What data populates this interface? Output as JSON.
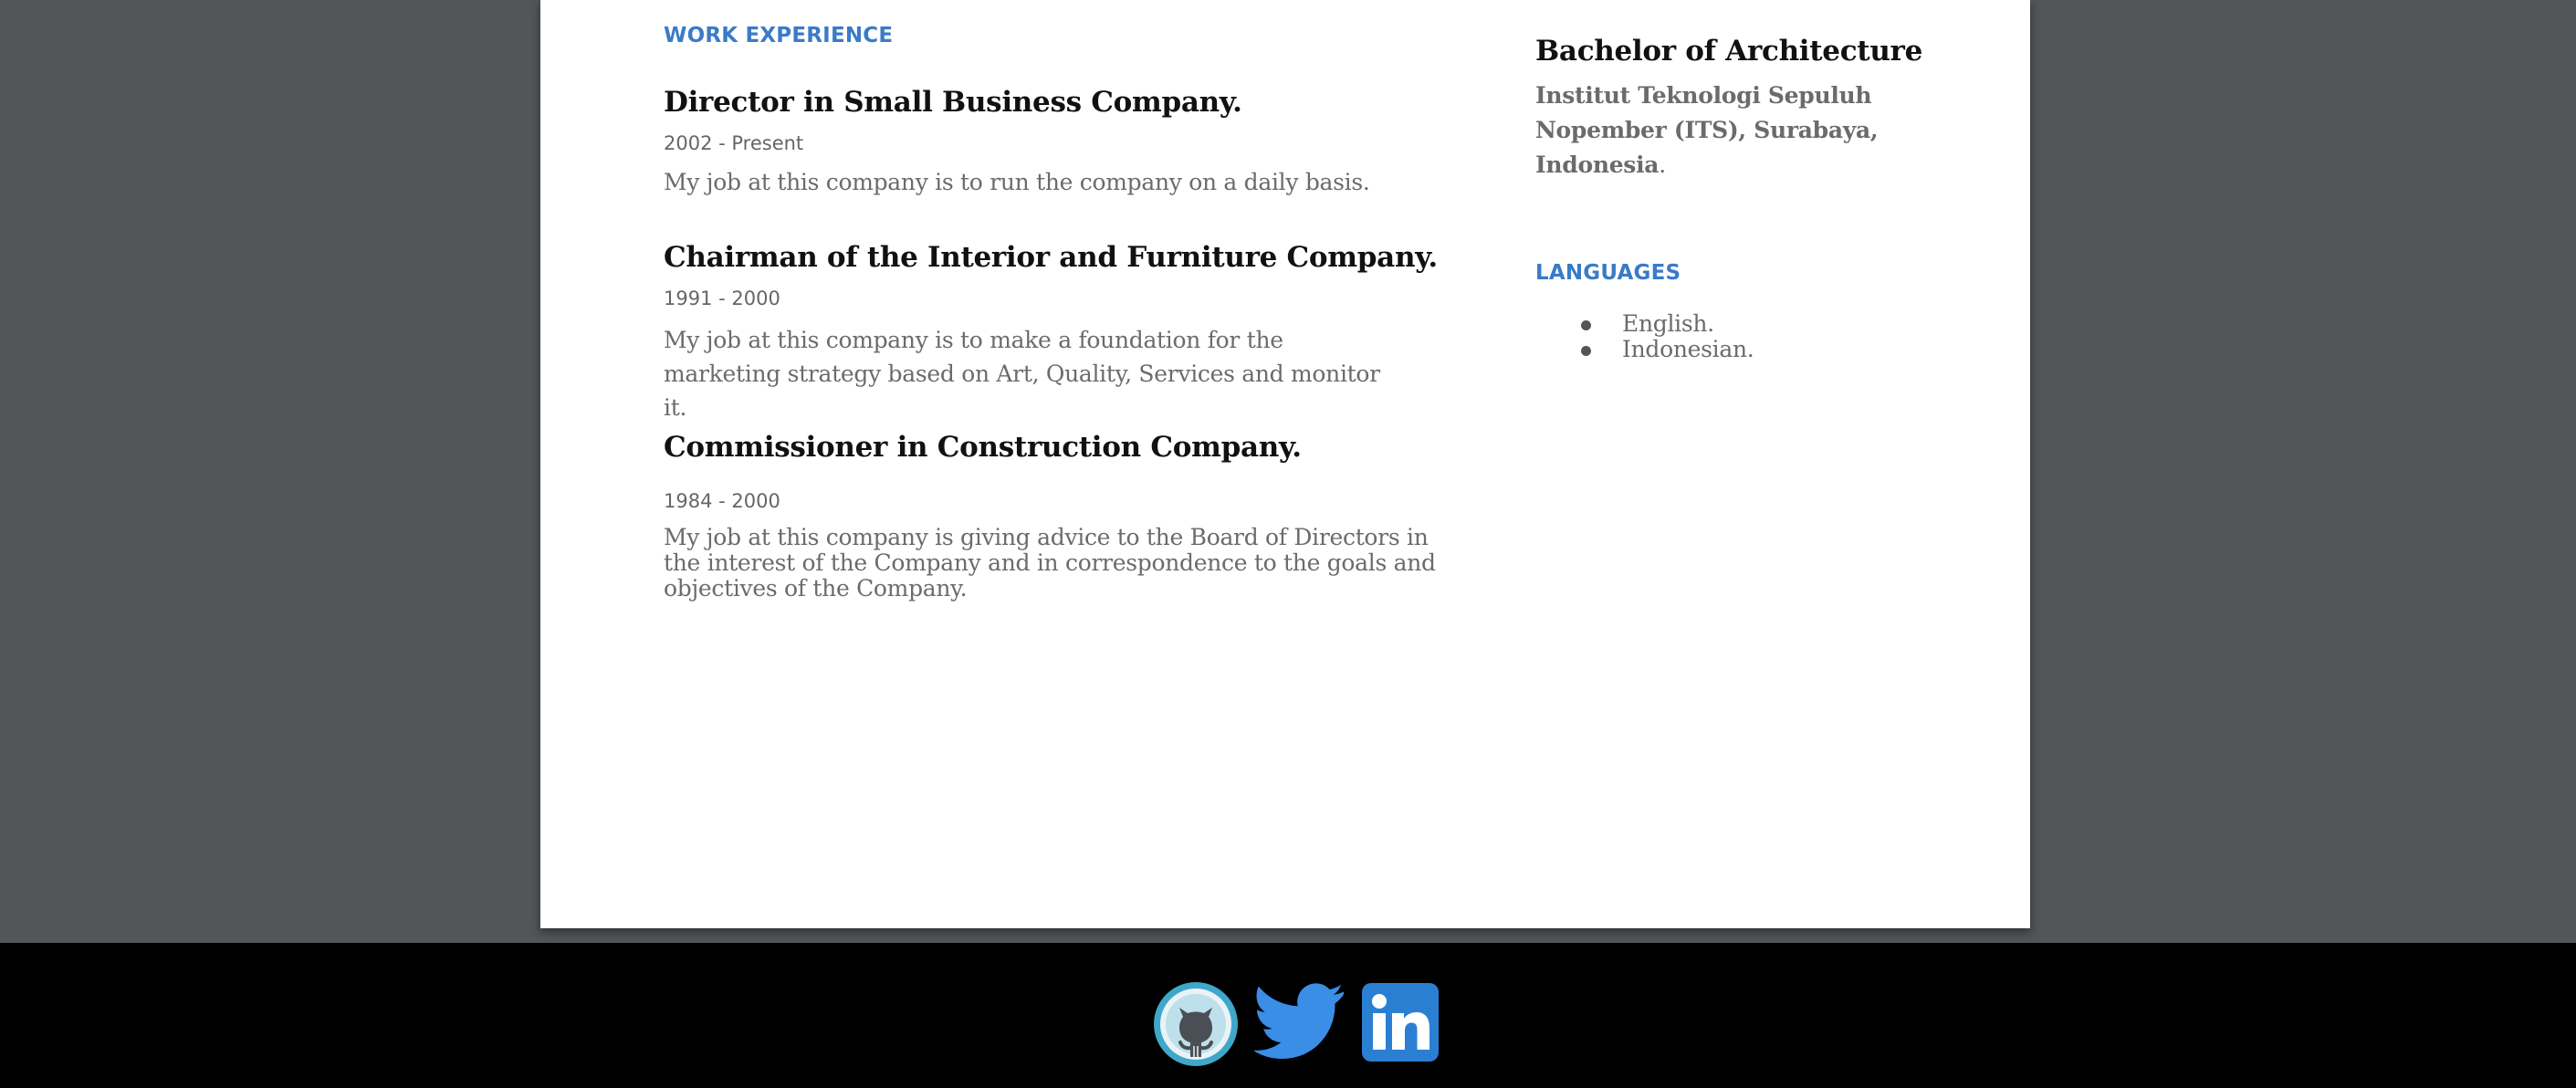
{
  "work": {
    "section_title": "WORK EXPERIENCE",
    "jobs": [
      {
        "title": "Director in Small Business Company.",
        "date": "2002 - Present",
        "description": "My job at this company is to run the company on a daily basis."
      },
      {
        "title": "Chairman of the Interior and Furniture Company.",
        "date": "1991 - 2000",
        "description": "My job at this company is to make a foundation for the marketing strategy based on Art, Quality,  Services and monitor it."
      },
      {
        "title": "Commissioner in Construction Company.",
        "date": "1984 - 2000",
        "description": "My job at this company is giving advice to the Board of Directors in the interest of the Company and in correspondence to the goals and objectives of the Company."
      }
    ]
  },
  "education": {
    "degree": "Bachelor of Architecture",
    "school": "Institut Teknologi Sepuluh Nopember (ITS), Surabaya, Indonesia",
    "school_suffix": "."
  },
  "languages": {
    "section_title": "LANGUAGES",
    "items": [
      "English.",
      "Indonesian."
    ]
  },
  "footer": {
    "icons": [
      "github-icon",
      "twitter-icon",
      "linkedin-icon"
    ],
    "colors": {
      "github_ring": "#3fa7c9",
      "twitter": "#3a8ee6",
      "linkedin": "#2b7fd3"
    }
  }
}
